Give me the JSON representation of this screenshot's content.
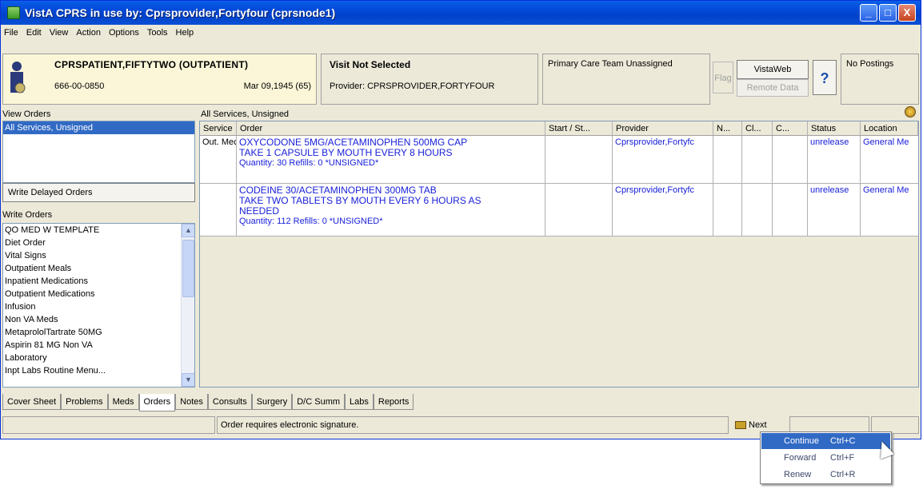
{
  "window": {
    "title": "VistA CPRS in use by: Cprsprovider,Fortyfour  (cprsnode1)",
    "buttons": [
      "_",
      "□",
      "X"
    ]
  },
  "menu": [
    "File",
    "Edit",
    "View",
    "Action",
    "Options",
    "Tools",
    "Help"
  ],
  "patient": {
    "name": "CPRSPATIENT,FIFTYTWO (OUTPATIENT)",
    "ssn": "666-00-0850",
    "dob": "Mar 09,1945 (65)"
  },
  "visit": {
    "title": "Visit Not Selected",
    "provider": "Provider:  CPRSPROVIDER,FORTYFOUR"
  },
  "team": "Primary Care Team Unassigned",
  "toolbar": {
    "flag": "Flag",
    "vistaweb": "VistaWeb",
    "remote_data": "Remote Data",
    "help": "?",
    "postings": "No Postings"
  },
  "view_orders": {
    "label": "View Orders",
    "items": [
      "All Services, Unsigned"
    ]
  },
  "write_delayed_orders": "Write Delayed Orders",
  "write_orders": {
    "label": "Write Orders",
    "items": [
      "QO MED W TEMPLATE",
      "Diet Order",
      "Vital Signs",
      "Outpatient Meals",
      "Inpatient Medications",
      "Outpatient Medications",
      "Infusion",
      "Non VA Meds",
      "MetaprololTartrate 50MG",
      "Aspirin 81 MG Non VA",
      "Laboratory",
      "Inpt Labs Routine Menu..."
    ]
  },
  "orders": {
    "heading": "All Services, Unsigned",
    "columns": [
      "Service",
      "Order",
      "Start / St...",
      "Provider",
      "N...",
      "Cl...",
      "C...",
      "Status",
      "Location"
    ],
    "rows": [
      {
        "service": "Out. Mec",
        "order_lines": [
          "OXYCODONE 5MG/ACETAMINOPHEN 500MG CAP",
          "TAKE 1 CAPSULE BY MOUTH EVERY 8 HOURS"
        ],
        "quantity": "Quantity: 30 Refills: 0 *UNSIGNED*",
        "start": "",
        "provider": "Cprsprovider,Fortyfc",
        "status": "unreleasе",
        "location": "General Me"
      },
      {
        "service": "",
        "order_lines": [
          "CODEINE 30/ACETAMINOPHEN 300MG TAB",
          "TAKE TWO TABLETS BY MOUTH EVERY 6 HOURS AS",
          "NEEDED"
        ],
        "quantity": "Quantity: 112 Refills: 0 *UNSIGNED*",
        "start": "",
        "provider": "Cprsprovider,Fortyfc",
        "status": "unreleasе",
        "location": "General Me"
      }
    ]
  },
  "tabs": [
    "Cover Sheet",
    "Problems",
    "Meds",
    "Orders",
    "Notes",
    "Consults",
    "Surgery",
    "D/C Summ",
    "Labs",
    "Reports"
  ],
  "active_tab": "Orders",
  "status": {
    "message": "Order requires electronic signature.",
    "next": "Next"
  },
  "context_menu": [
    {
      "label": "Continue",
      "shortcut": "Ctrl+C",
      "selected": true
    },
    {
      "label": "Forward",
      "shortcut": "Ctrl+F",
      "selected": false
    },
    {
      "label": "Renew",
      "shortcut": "Ctrl+R",
      "selected": false
    }
  ]
}
